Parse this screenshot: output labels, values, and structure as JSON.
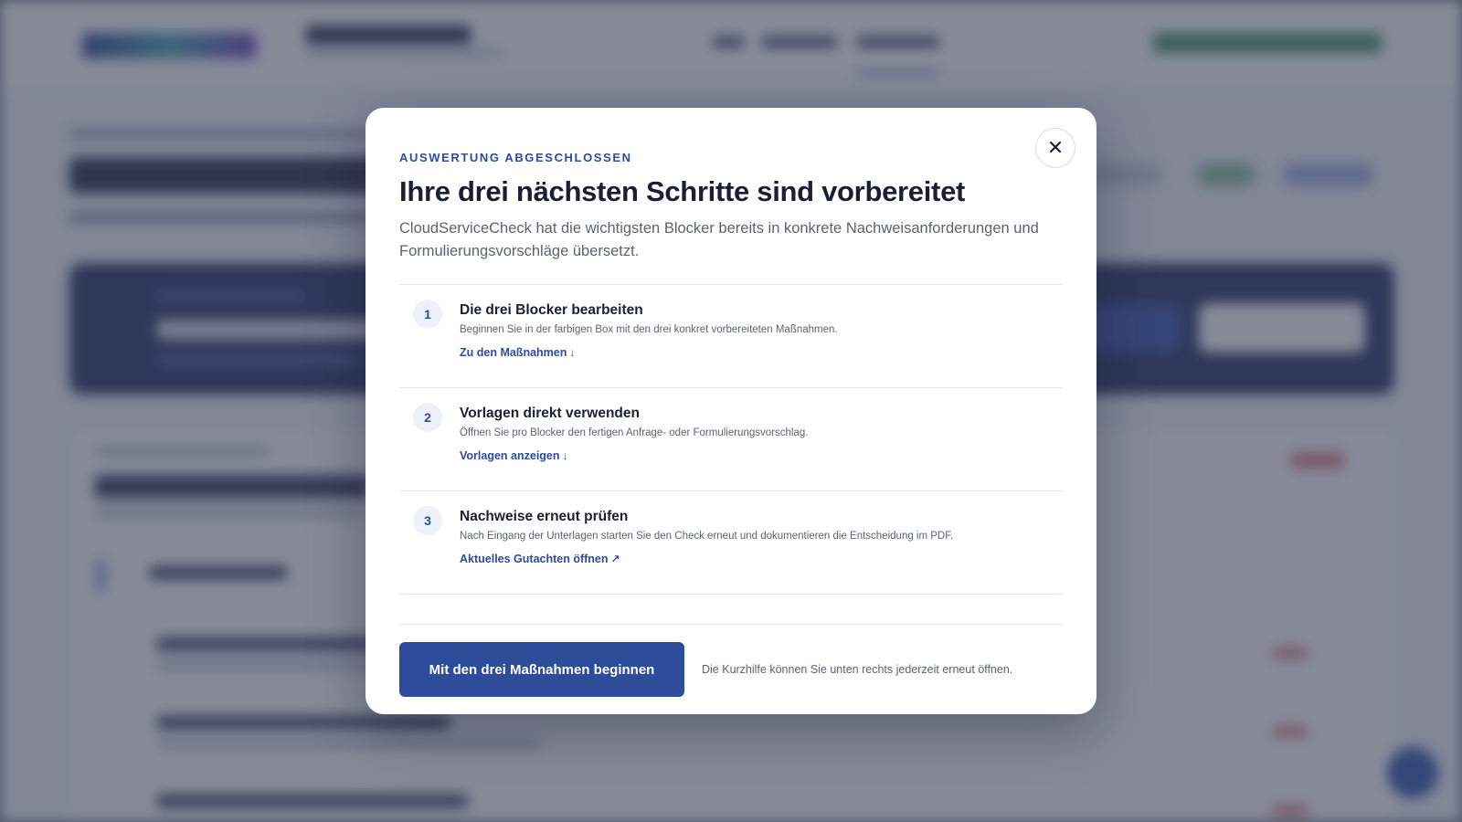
{
  "modal": {
    "eyebrow": "AUSWERTUNG ABGESCHLOSSEN",
    "title": "Ihre drei nächsten Schritte sind vorbereitet",
    "intro": "CloudServiceCheck hat die wichtigsten Blocker bereits in konkrete Nachweisanforderungen und Formulierungsvorschläge übersetzt.",
    "close_icon": "close-icon",
    "steps": [
      {
        "number": "1",
        "title": "Die drei Blocker bearbeiten",
        "description": "Beginnen Sie in der farbigen Box mit den drei konkret vorbereiteten Maßnahmen.",
        "link_label": "Zu den Maßnahmen",
        "link_icon": "↓"
      },
      {
        "number": "2",
        "title": "Vorlagen direkt verwenden",
        "description": "Öffnen Sie pro Blocker den fertigen Anfrage- oder Formulierungsvorschlag.",
        "link_label": "Vorlagen anzeigen",
        "link_icon": "↓"
      },
      {
        "number": "3",
        "title": "Nachweise erneut prüfen",
        "description": "Nach Eingang der Unterlagen starten Sie den Check erneut und dokumentieren die Entscheidung im PDF.",
        "link_label": "Aktuelles Gutachten öffnen",
        "link_icon": "↗"
      }
    ],
    "primary_button": "Mit den drei Maßnahmen beginnen",
    "footer_note": "Die Kurzhilfe können Sie unten rechts jederzeit erneut öffnen."
  },
  "colors": {
    "accent": "#2d4d9b",
    "overlay": "#5d6275",
    "text": "#1a1f36"
  }
}
